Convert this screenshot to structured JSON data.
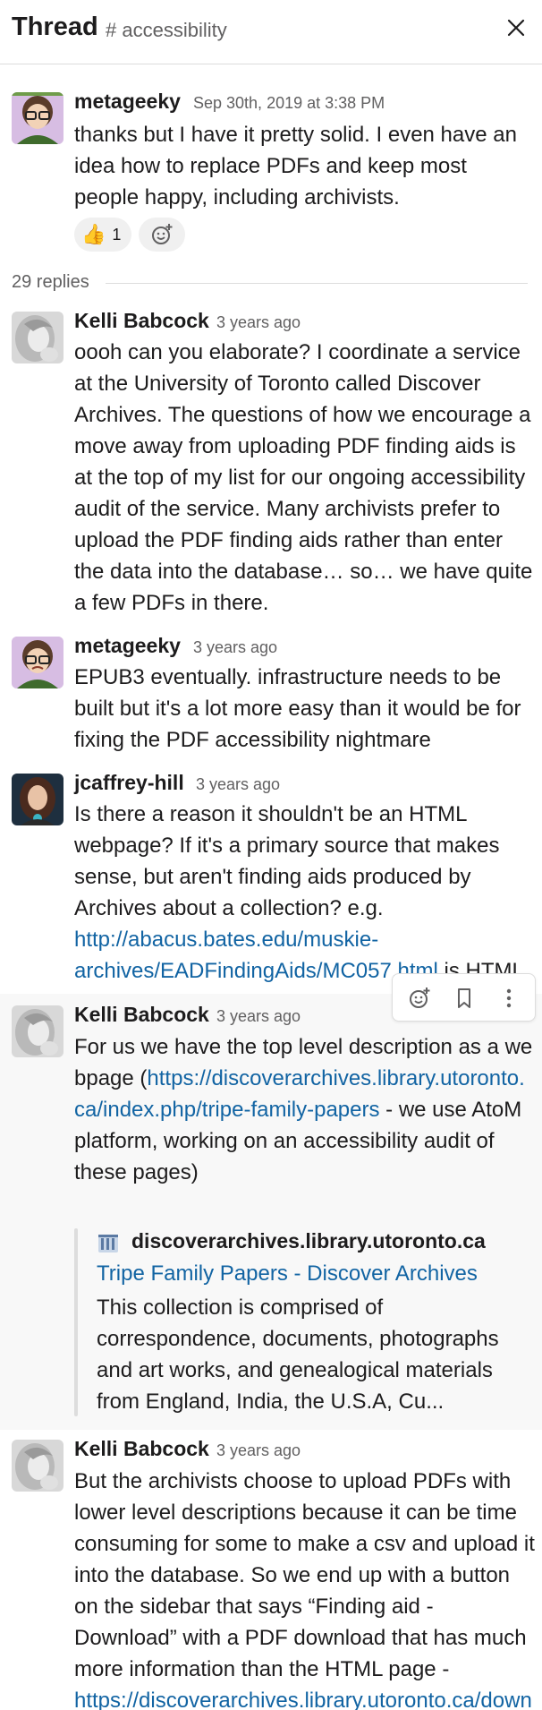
{
  "header": {
    "title": "Thread",
    "channel": "# accessibility"
  },
  "parent": {
    "author": "metageeky",
    "time": "Sep 30th, 2019 at 3:38 PM",
    "text": "thanks but I have it pretty solid. I even have an idea how to replace PDFs and keep most people happy, including archivists.",
    "reaction": {
      "emoji": "👍",
      "count": "1"
    }
  },
  "replies_label": "29 replies",
  "messages": [
    {
      "author": "Kelli Babcock",
      "time": "3 years ago",
      "text": "oooh can you elaborate? I coordinate a service at the University of Toronto called Discover Archives. The questions of how we encourage a move away from uploading PDF finding aids is at the top of my list for our ongoing accessibility audit of the service. Many archivists prefer to upload the PDF finding aids rather than enter the data into the database… so… we have quite a few PDFs in there."
    },
    {
      "author": "metageeky",
      "time": "3 years ago",
      "text": "EPUB3 eventually. infrastructure needs to be built but it's a lot more easy than it would be for fixing the PDF accessibility nightmare"
    },
    {
      "author": "jcaffrey-hill",
      "time": "3 years ago",
      "text": "Is there a reason it shouldn't be an HTML webpage? If it's a primary source that makes sense, but aren't finding aids produced by Archives about a collection? e.g. ",
      "link": "http://abacus.bates.edu/muskie-archives/EADFindingAids/MC057.html",
      "text_after": " is HTML"
    },
    {
      "author": "Kelli Babcock",
      "time": "3 years ago",
      "text_before": "For us we have the top level description as a webpage (",
      "link": "https://discoverarchives.library.utoronto.ca/index.php/tripe-family-papers",
      "text_after": " - we use AtoM platform, working on an accessibility audit of these pages)",
      "unfurl": {
        "site": "discoverarchives.library.utoronto.ca",
        "title": "Tripe Family Papers - Discover Archives",
        "description": "This collection is comprised of correspondence, documents, photographs and art works, and genealogical materials from England, India, the U.S.A, Cu..."
      }
    },
    {
      "author": "Kelli Babcock",
      "time": "3 years ago",
      "text": "But the archivists choose to upload PDFs with lower level descriptions because it can be time consuming for some to make a csv and upload it into the database. So we end up with a button on the sidebar that says “Finding aid - Download” with a PDF download that has much more information than the HTML page - ",
      "link": "https://discoverarchives.library.utoronto.ca/down"
    }
  ],
  "colors": {
    "link": "#1264a3",
    "muted": "#616061",
    "text": "#1d1c1d",
    "hover_bg": "#f8f8f8"
  },
  "icons": [
    "close-icon",
    "add-reaction-icon",
    "bookmark-icon",
    "more-actions-icon",
    "site-favicon-icon"
  ]
}
